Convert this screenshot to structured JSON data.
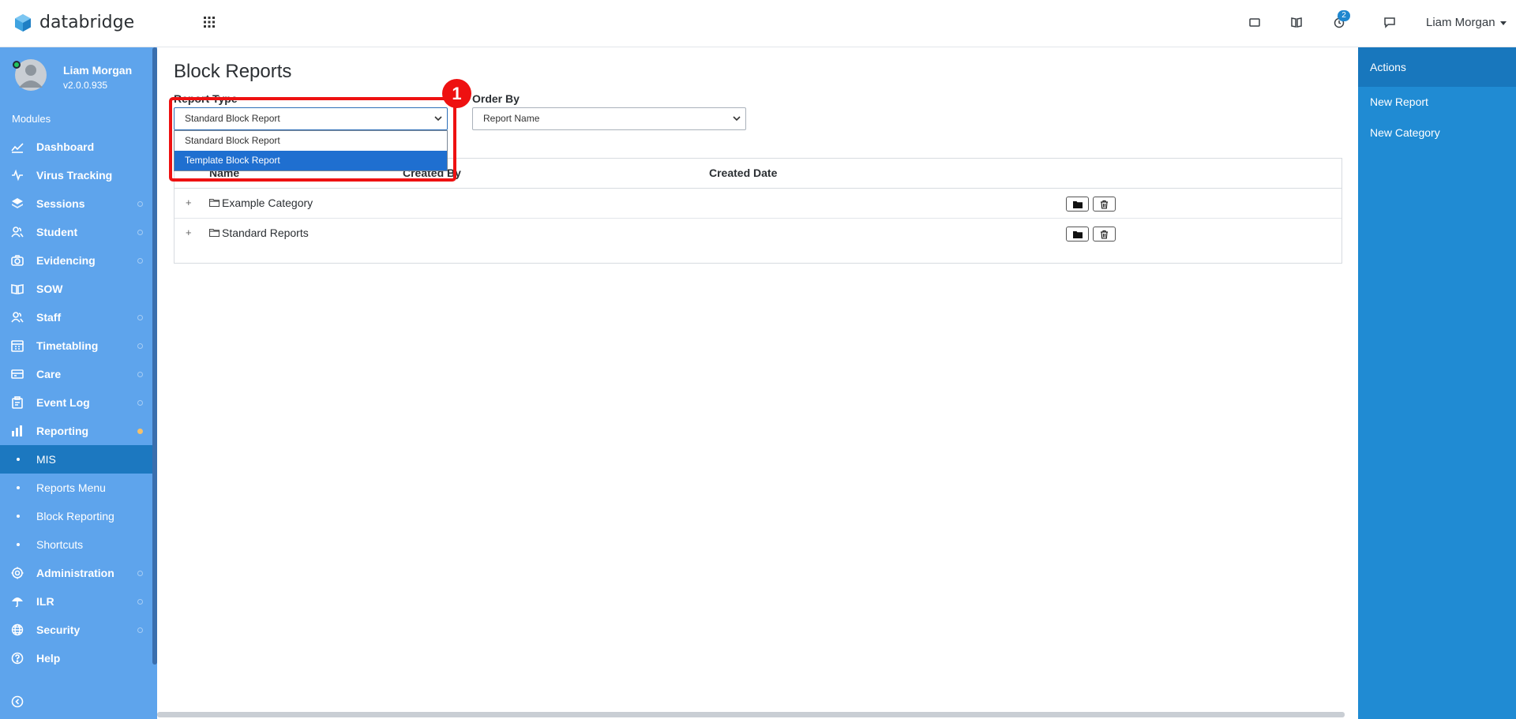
{
  "app": {
    "name": "databridge"
  },
  "topbar": {
    "notification_count": "2",
    "user_name": "Liam Morgan"
  },
  "sidebar": {
    "user_name": "Liam Morgan",
    "version": "v2.0.0.935",
    "modules_label": "Modules",
    "items": [
      {
        "label": "Dashboard",
        "icon": "chart-line-icon"
      },
      {
        "label": "Virus Tracking",
        "icon": "pulse-icon"
      },
      {
        "label": "Sessions",
        "icon": "layers-icon"
      },
      {
        "label": "Student",
        "icon": "users-icon"
      },
      {
        "label": "Evidencing",
        "icon": "camera-icon"
      },
      {
        "label": "SOW",
        "icon": "book-open-icon"
      },
      {
        "label": "Staff",
        "icon": "users-icon"
      },
      {
        "label": "Timetabling",
        "icon": "calendar-icon"
      },
      {
        "label": "Care",
        "icon": "card-icon"
      },
      {
        "label": "Event Log",
        "icon": "clipboard-icon"
      },
      {
        "label": "Reporting",
        "icon": "bar-chart-icon"
      }
    ],
    "sub_items": [
      {
        "label": "MIS"
      },
      {
        "label": "Reports Menu"
      },
      {
        "label": "Block Reporting"
      },
      {
        "label": "Shortcuts"
      }
    ],
    "bottom_items": [
      {
        "label": "Administration",
        "icon": "gear-icon"
      },
      {
        "label": "ILR",
        "icon": "umbrella-icon"
      },
      {
        "label": "Security",
        "icon": "globe-icon"
      },
      {
        "label": "Help",
        "icon": "help-icon"
      }
    ]
  },
  "main": {
    "title": "Block Reports",
    "report_type": {
      "label": "Report Type",
      "value": "Standard Block Report"
    },
    "dropdown_options": [
      "Standard Block Report",
      "Template Block Report"
    ],
    "order_by": {
      "label": "Order By",
      "value": "Report Name"
    },
    "step_number": "1",
    "table": {
      "headers": [
        "Name",
        "Created By",
        "Created Date"
      ],
      "rows": [
        {
          "name": "Example Category"
        },
        {
          "name": "Standard Reports"
        }
      ],
      "expand_symbol": "+"
    }
  },
  "actions_panel": {
    "title": "Actions",
    "links": [
      "New Report",
      "New Category"
    ]
  },
  "colors": {
    "sidebar": "#5ea4ec",
    "sidebar_active": "#1c78c0",
    "right_panel": "#208bd3",
    "right_panel_header": "#1877bd",
    "highlight": "#ee1111",
    "dropdown_selected": "#1f6fd0"
  }
}
